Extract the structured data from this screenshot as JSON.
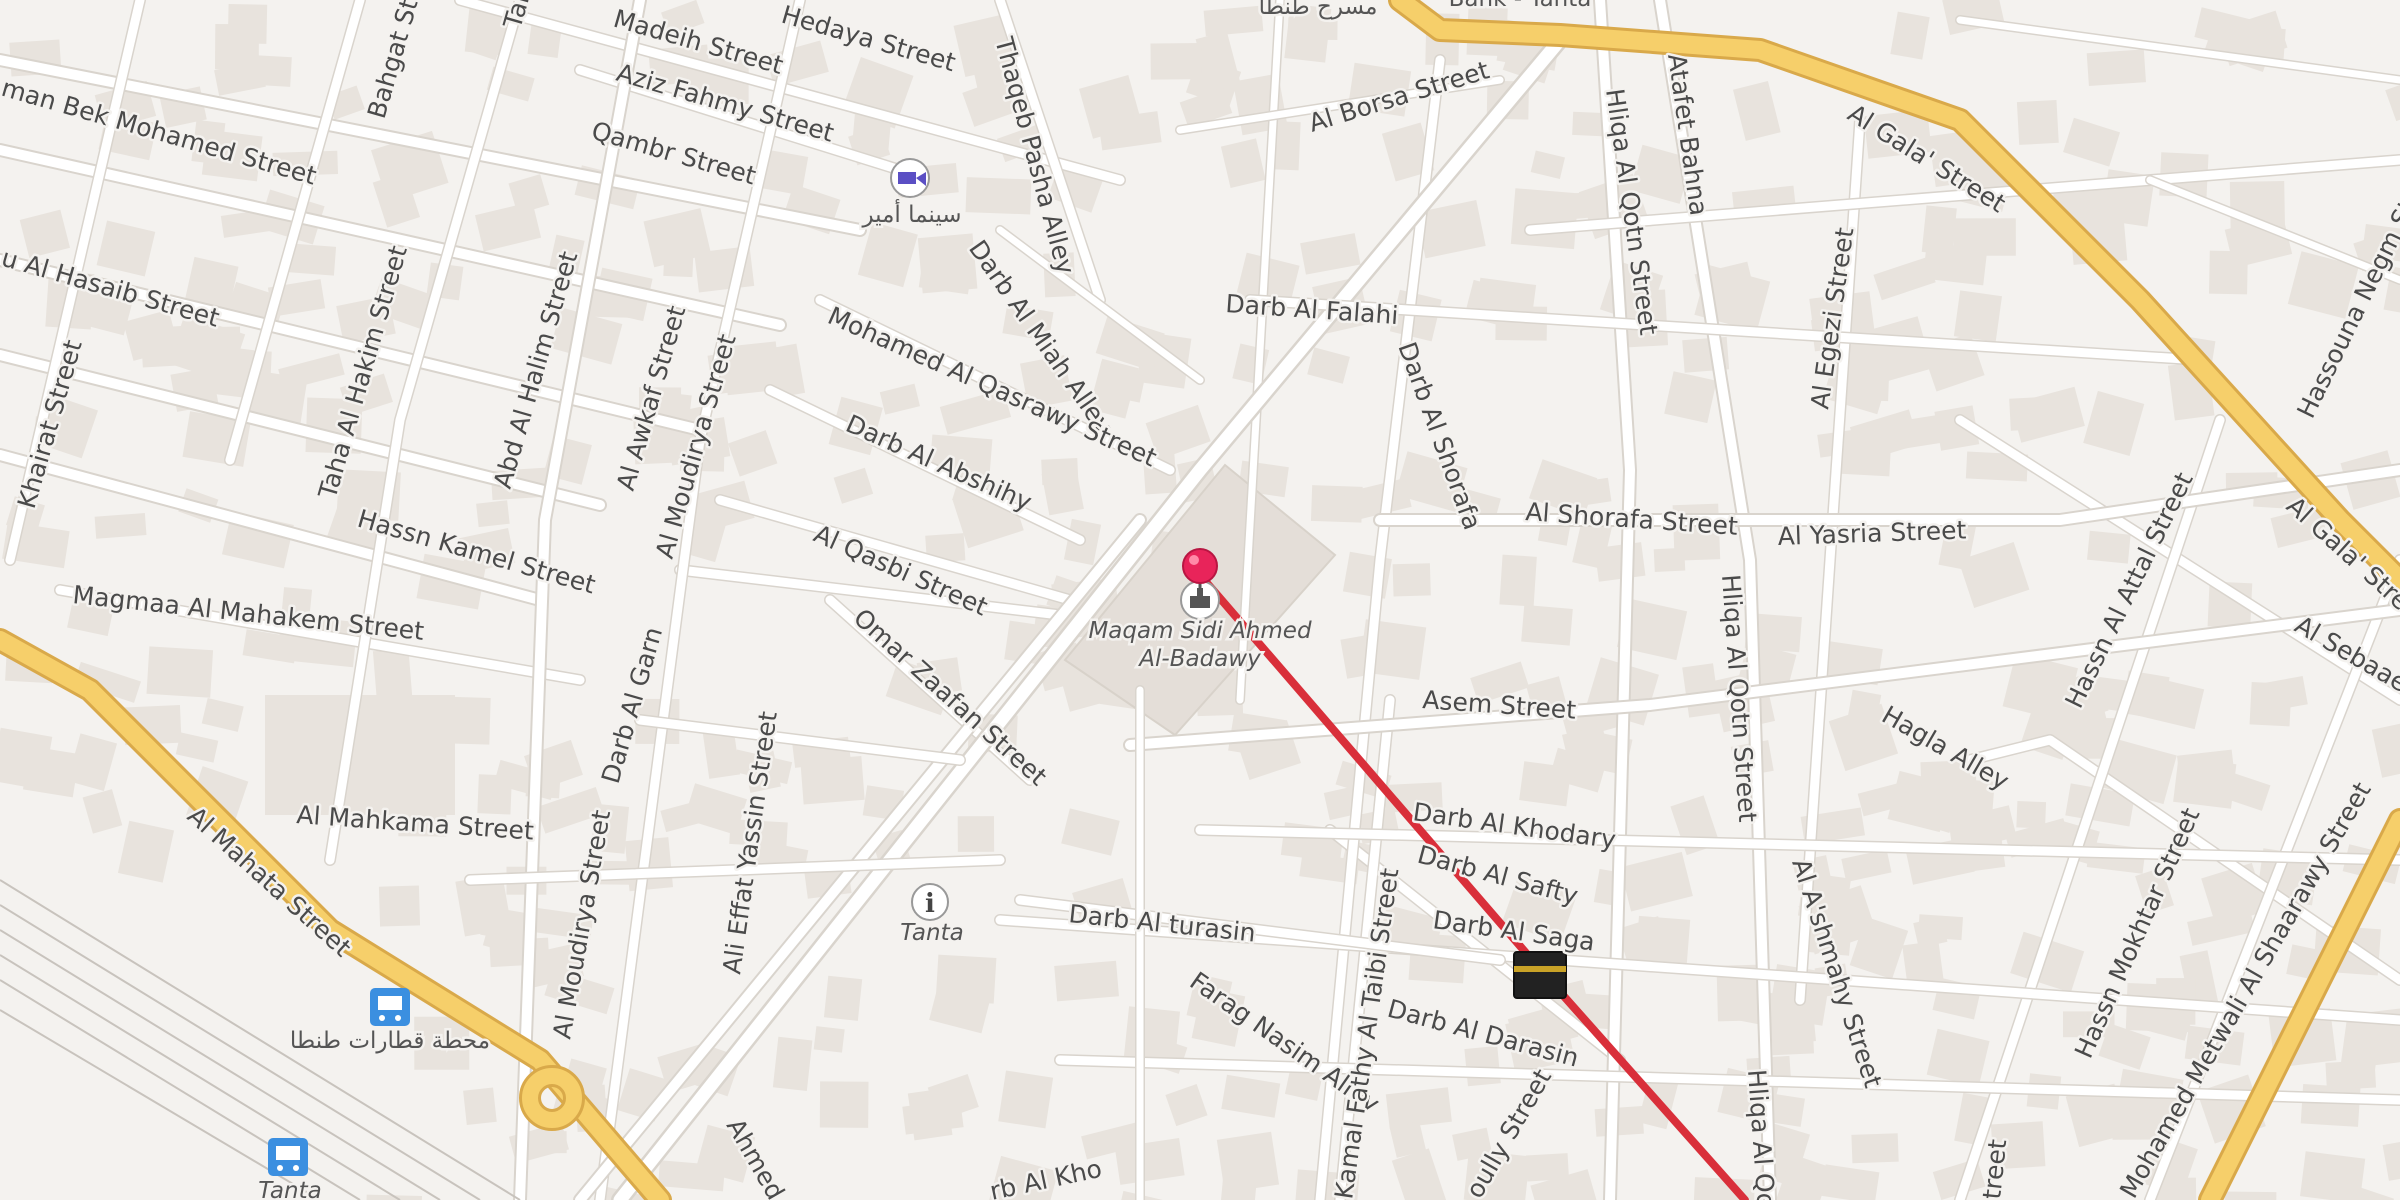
{
  "map": {
    "colors": {
      "background": "#f4f2ef",
      "block": "#e8e3dd",
      "street": "#ffffff",
      "street_casing": "#d9d4cd",
      "major_road": "#f6cf6a",
      "major_road_casing": "#d9a94a",
      "route": "#d92f3a",
      "pin": "#e8245a"
    },
    "streets": [
      "Madeih Street",
      "Hedaya Street",
      "Aziz Fahmy Street",
      "Qambr Street",
      "man Bek Mohamed Street",
      "Bahgat Stre",
      "Thaqeb Pasha Alley",
      "Al Borsa Street",
      "Atafet Bahna",
      "Al Gala' Street",
      "Hliqa Al Qotn Street",
      "u Al Hasaib Street",
      "Khairat Street",
      "Taha Al Hakim Street",
      "Abd Al Halim Street",
      "Al Awkaf Street",
      "Al Moudirya Street",
      "Darb Al Miah Alley",
      "Mohamed Al Qasrawy Street",
      "Darb Al Abshihy",
      "Darb Al Falahi",
      "Darb Al Shorafa",
      "Al Shorafa Street",
      "Al Yasria Street",
      "Al Egezi Street",
      "Hassouna Negm Street",
      "Al Gala' Stre",
      "Hassn Kamel Street",
      "Magmaa Al Mahakem Street",
      "Al Qasbi Street",
      "Omar Zaafan Street",
      "Hliqa Al Qotn Street",
      "Asem Street",
      "Hassn Al Attal Street",
      "Al Sebaael",
      "Hagla Alley",
      "Darb Al Garn",
      "Ali Effat Yassin Street",
      "Al Mahkama Street",
      "Al Mahata Street",
      "Al Moudirya Street",
      "Darb Al Khodary",
      "Darb Al Safty",
      "Darb Al turasin",
      "Darb Al Saga",
      "Farag Nasim Alley",
      "Kamal Fathy Al Taibi Street",
      "Darb Al Darasin",
      "Al A'shmahy Street",
      "Hassn Mokhtar Street",
      "Mohamed Metwali Al Shaarawy Street",
      "Hliqa Al Qo",
      "Ahmed",
      "rb Al Kho",
      "oully Street",
      "Tal",
      "treet"
    ],
    "pois": {
      "landmark_name": "Maqam Sidi Ahmed\nAl-Badawy",
      "landmark_line1": "Maqam Sidi Ahmed",
      "landmark_line2": "Al-Badawy",
      "cinema_label": "سينما أمير",
      "theatre_label": "مسرح طنطا",
      "bank_label": "Bank - Tanta",
      "info_label": "Tanta",
      "station_label": "محطة قطارات طنطا",
      "station2_label": "Tanta"
    },
    "route": {
      "present": true
    }
  }
}
